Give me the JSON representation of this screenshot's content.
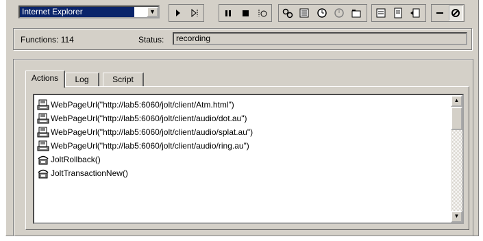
{
  "toolbar": {
    "browser_select": {
      "value": "Internet Explorer"
    }
  },
  "status_bar": {
    "functions_label": "Functions:  114",
    "status_label": "Status:",
    "status_value": "recording"
  },
  "tabs": [
    {
      "label": "Actions",
      "active": true
    },
    {
      "label": "Log",
      "active": false
    },
    {
      "label": "Script",
      "active": false
    }
  ],
  "actions": {
    "items": [
      {
        "text": "WebPageUrl(\"http://lab5:6060/jolt/client/Atm.html\")",
        "icon": "page-icon"
      },
      {
        "text": "WebPageUrl(\"http://lab5:6060/jolt/client/audio/dot.au\")",
        "icon": "page-icon"
      },
      {
        "text": "WebPageUrl(\"http://lab5:6060/jolt/client/audio/splat.au\")",
        "icon": "page-icon"
      },
      {
        "text": "WebPageUrl(\"http://lab5:6060/jolt/client/audio/ring.au\")",
        "icon": "page-icon"
      },
      {
        "text": "JoltRollback()",
        "icon": "jolt-icon"
      },
      {
        "text": "JoltTransactionNew()",
        "icon": "jolt-icon"
      }
    ]
  }
}
